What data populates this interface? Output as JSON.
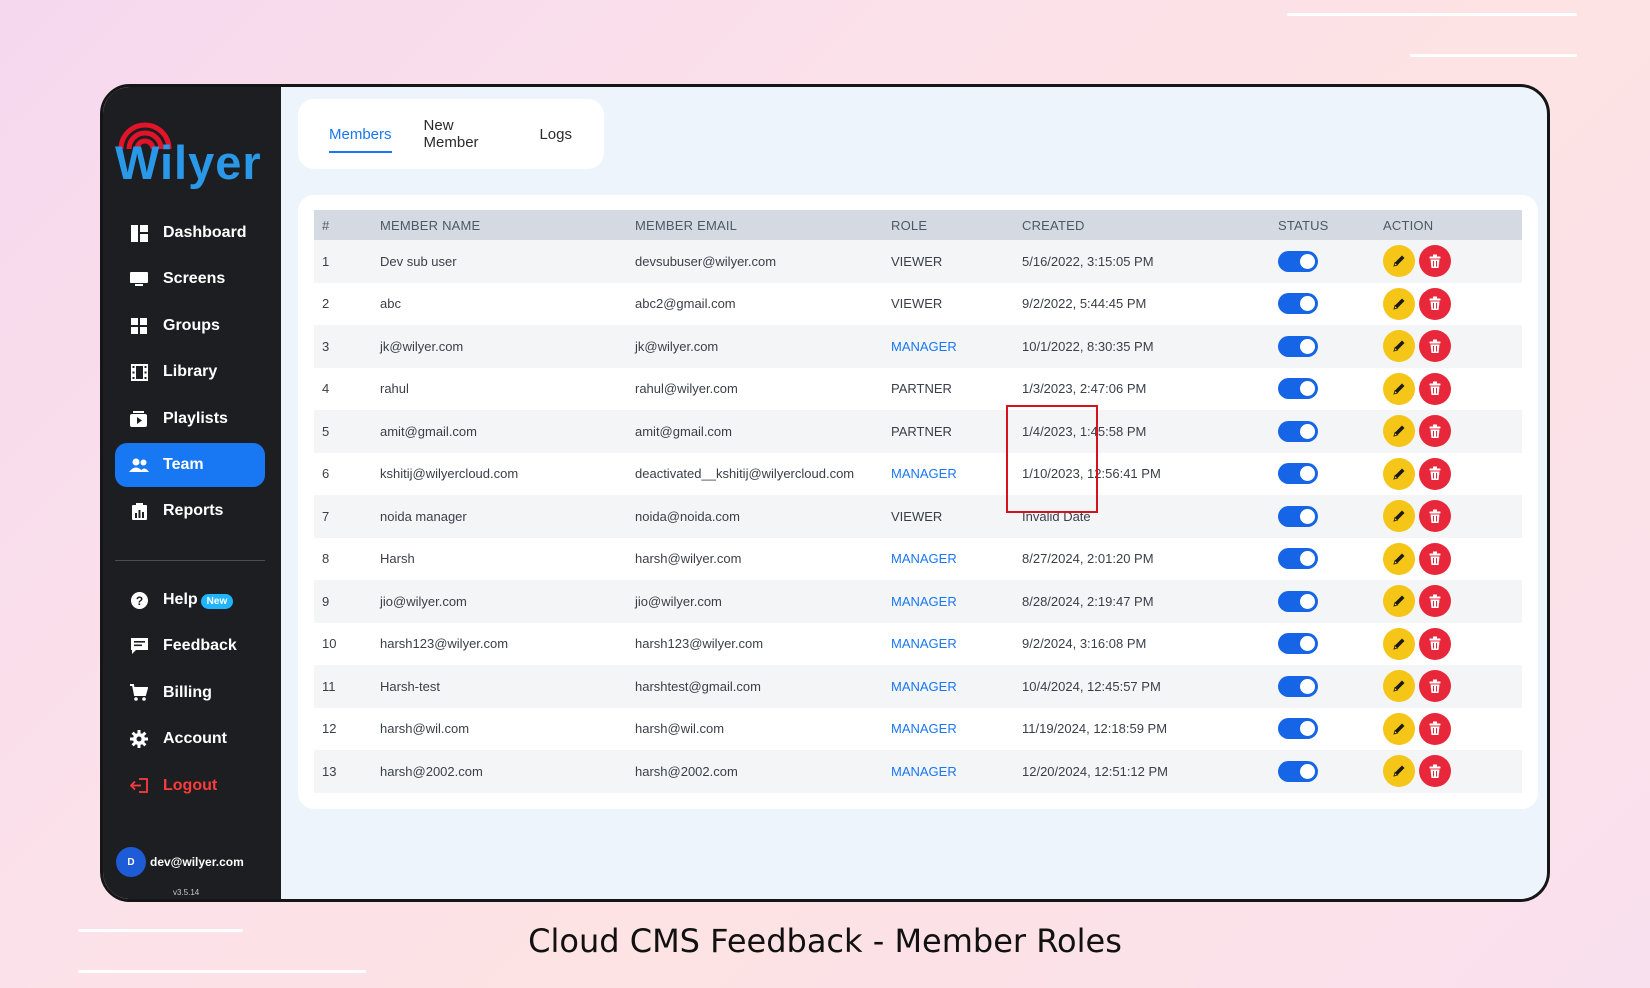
{
  "brand": {
    "name": "Wilyer",
    "accent": "#1877f2"
  },
  "nav": {
    "items": [
      {
        "label": "Dashboard",
        "icon": "dashboard-icon"
      },
      {
        "label": "Screens",
        "icon": "monitor-icon"
      },
      {
        "label": "Groups",
        "icon": "grid-icon"
      },
      {
        "label": "Library",
        "icon": "film-icon"
      },
      {
        "label": "Playlists",
        "icon": "playlist-icon"
      },
      {
        "label": "Team",
        "icon": "team-icon",
        "active": true
      },
      {
        "label": "Reports",
        "icon": "report-icon"
      }
    ],
    "secondary": [
      {
        "label": "Help",
        "icon": "help-icon",
        "badge": "New"
      },
      {
        "label": "Feedback",
        "icon": "feedback-icon"
      },
      {
        "label": "Billing",
        "icon": "cart-icon"
      },
      {
        "label": "Account",
        "icon": "gear-icon"
      },
      {
        "label": "Logout",
        "icon": "logout-icon"
      }
    ]
  },
  "user": {
    "initial": "D",
    "email": "dev@wilyer.com",
    "version": "v3.5.14"
  },
  "tabs": [
    "Members",
    "New Member",
    "Logs"
  ],
  "table": {
    "headers": [
      "#",
      "MEMBER NAME",
      "MEMBER EMAIL",
      "ROLE",
      "CREATED",
      "STATUS",
      "ACTION"
    ],
    "rows": [
      {
        "n": "1",
        "name": "Dev sub user",
        "email": "devsubuser@wilyer.com",
        "role": "VIEWER",
        "created": "5/16/2022, 3:15:05 PM"
      },
      {
        "n": "2",
        "name": "abc",
        "email": "abc2@gmail.com",
        "role": "VIEWER",
        "created": "9/2/2022, 5:44:45 PM"
      },
      {
        "n": "3",
        "name": "jk@wilyer.com",
        "email": "jk@wilyer.com",
        "role": "MANAGER",
        "created": "10/1/2022, 8:30:35 PM"
      },
      {
        "n": "4",
        "name": "rahul",
        "email": "rahul@wilyer.com",
        "role": "PARTNER",
        "created": "1/3/2023, 2:47:06 PM"
      },
      {
        "n": "5",
        "name": "amit@gmail.com",
        "email": "amit@gmail.com",
        "role": "PARTNER",
        "created": "1/4/2023, 1:45:58 PM"
      },
      {
        "n": "6",
        "name": "kshitij@wilyercloud.com",
        "email": "deactivated__kshitij@wilyercloud.com",
        "role": "MANAGER",
        "created": "1/10/2023, 12:56:41 PM"
      },
      {
        "n": "7",
        "name": "noida manager",
        "email": "noida@noida.com",
        "role": "VIEWER",
        "created": "Invalid Date"
      },
      {
        "n": "8",
        "name": "Harsh",
        "email": "harsh@wilyer.com",
        "role": "MANAGER",
        "created": "8/27/2024, 2:01:20 PM"
      },
      {
        "n": "9",
        "name": "jio@wilyer.com",
        "email": "jio@wilyer.com",
        "role": "MANAGER",
        "created": "8/28/2024, 2:19:47 PM"
      },
      {
        "n": "10",
        "name": "harsh123@wilyer.com",
        "email": "harsh123@wilyer.com",
        "role": "MANAGER",
        "created": "9/2/2024, 3:16:08 PM"
      },
      {
        "n": "11",
        "name": "Harsh-test",
        "email": "harshtest@gmail.com",
        "role": "MANAGER",
        "created": "10/4/2024, 12:45:57 PM"
      },
      {
        "n": "12",
        "name": "harsh@wil.com",
        "email": "harsh@wil.com",
        "role": "MANAGER",
        "created": "11/19/2024, 12:18:59 PM"
      },
      {
        "n": "13",
        "name": "harsh@2002.com",
        "email": "harsh@2002.com",
        "role": "MANAGER",
        "created": "12/20/2024, 12:51:12 PM"
      }
    ]
  },
  "caption": "Cloud CMS Feedback - Member Roles"
}
